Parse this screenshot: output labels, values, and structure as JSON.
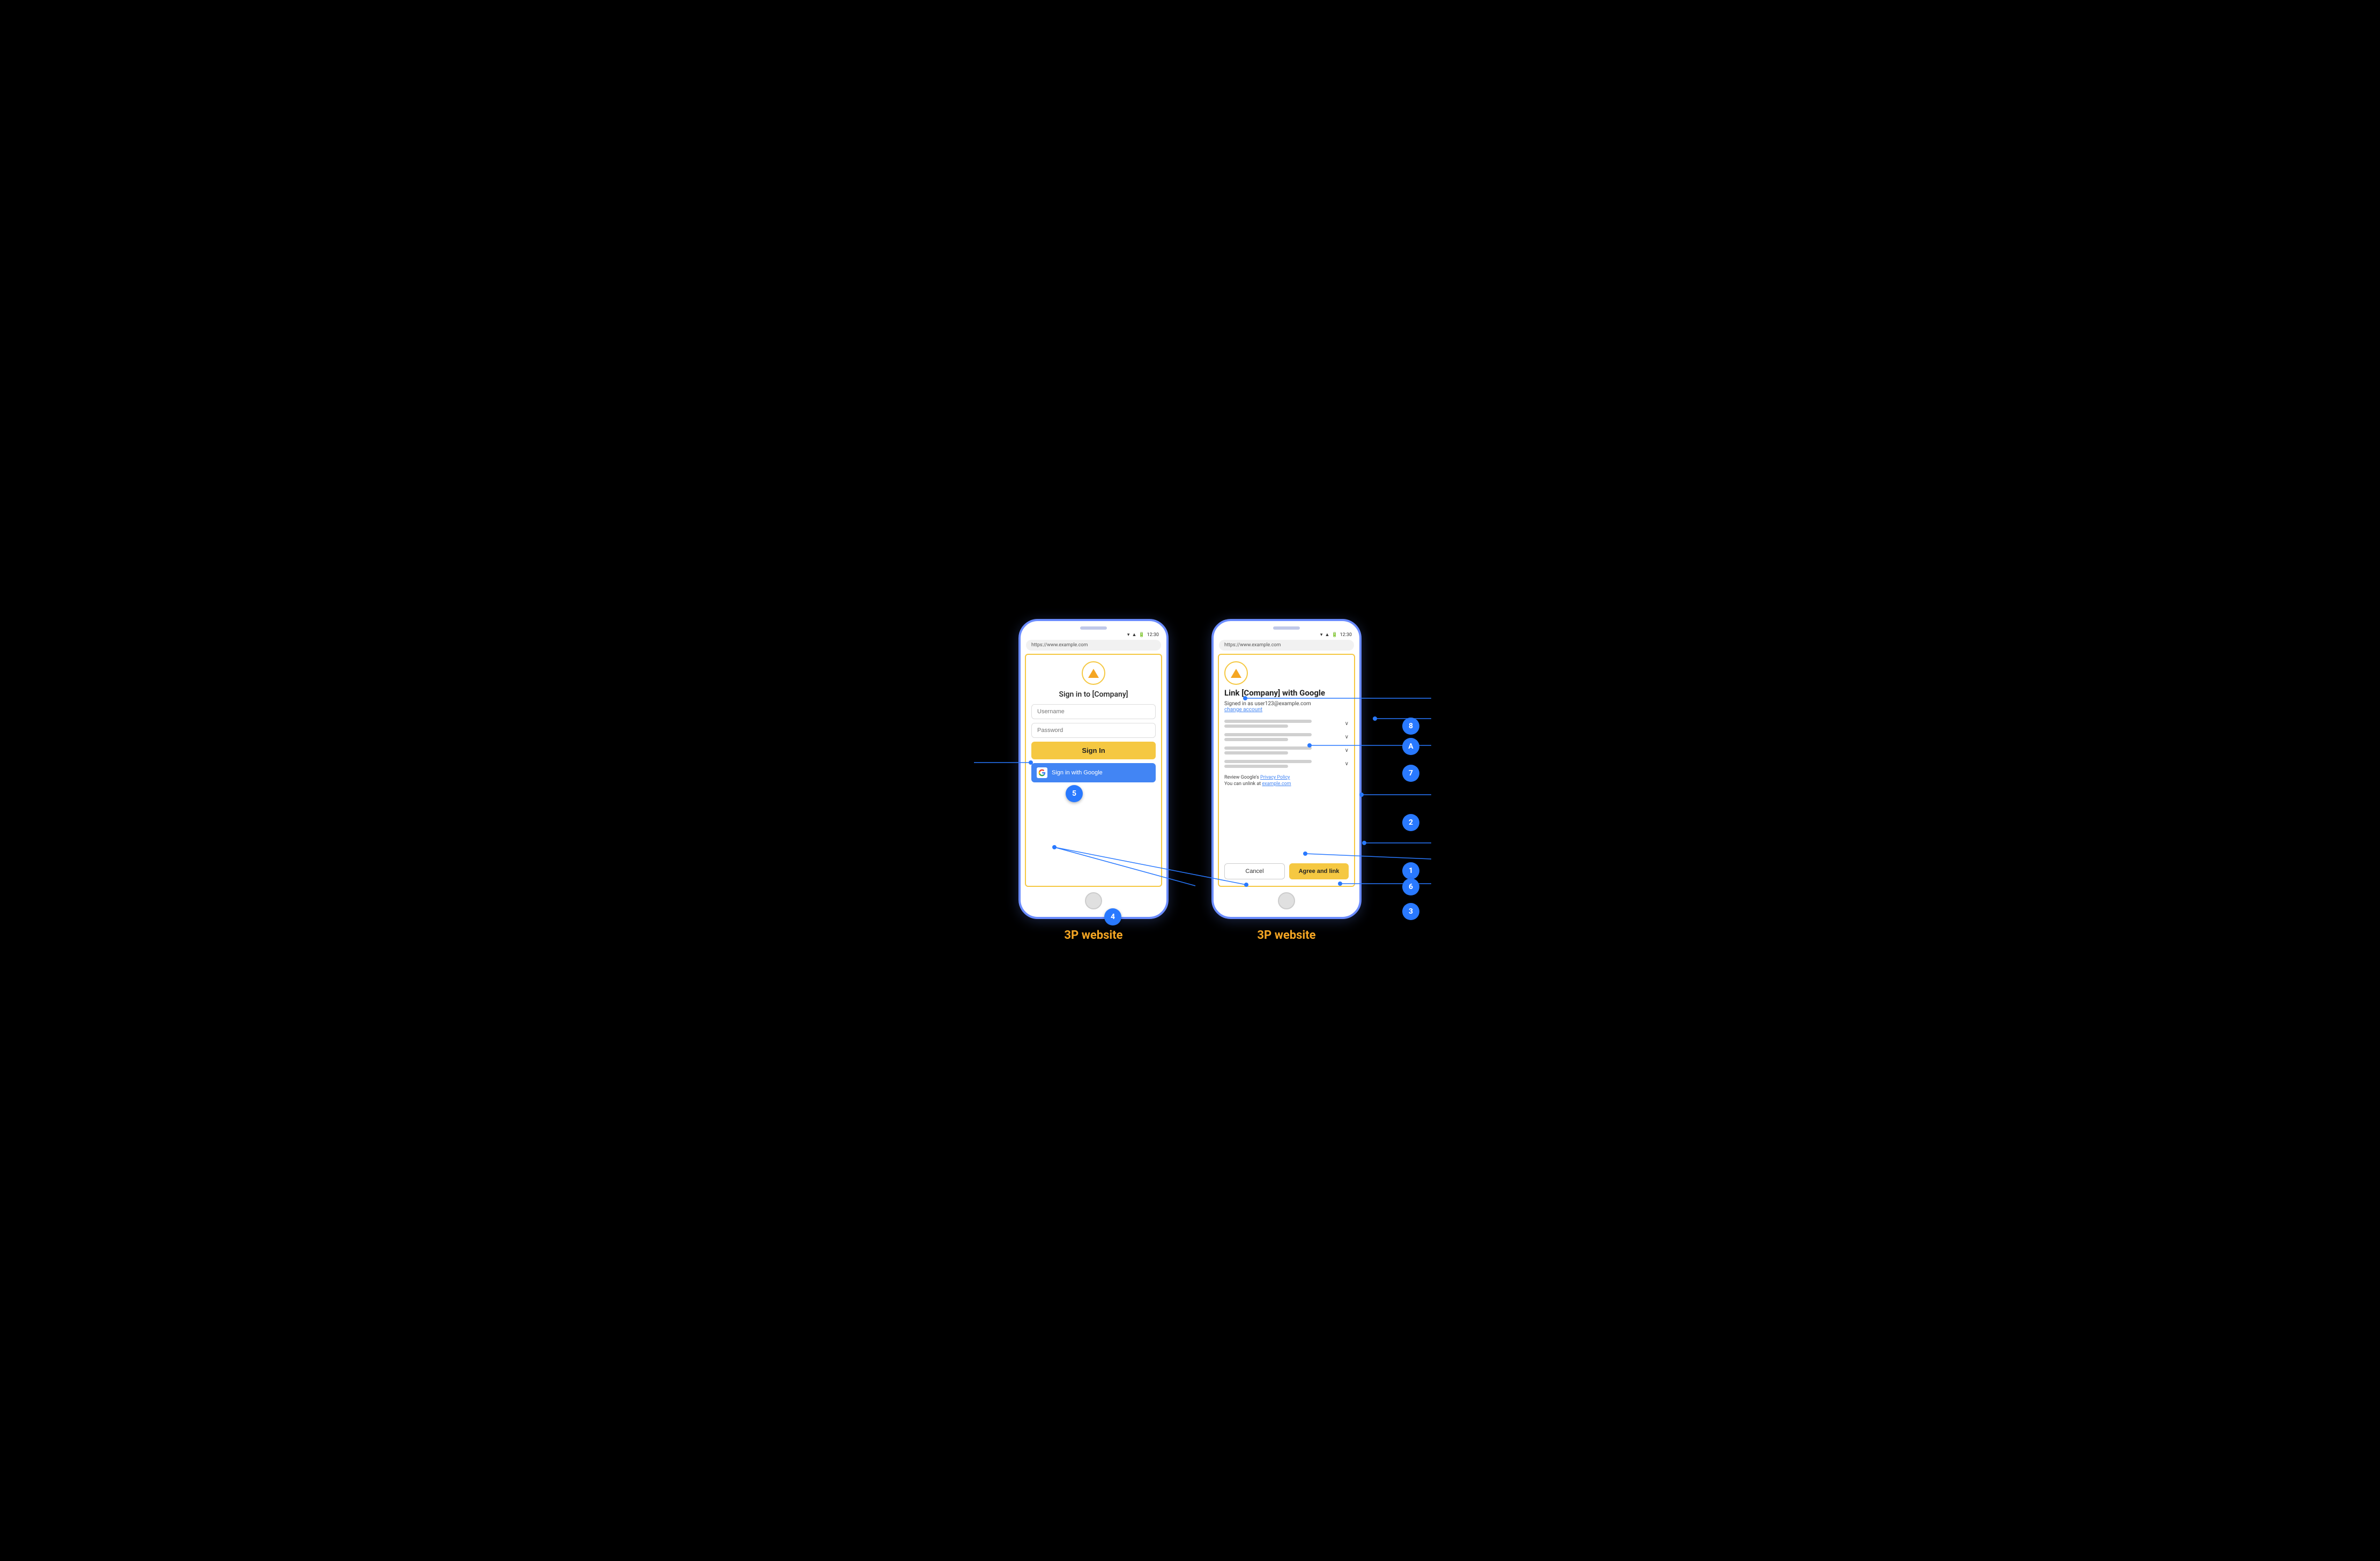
{
  "diagram": {
    "background": "#000000",
    "phones": [
      {
        "id": "left-phone",
        "label": "3P website",
        "url": "https://www.example.com",
        "time": "12:30",
        "content": {
          "logo": "triangle",
          "title": "Sign in to [Company]",
          "username_placeholder": "Username",
          "password_placeholder": "Password",
          "signin_button": "Sign In",
          "google_button": "Sign in with Google"
        }
      },
      {
        "id": "right-phone",
        "label": "3P website",
        "url": "https://www.example.com",
        "time": "12:30",
        "content": {
          "logo": "triangle",
          "title": "Link [Company] with Google",
          "signed_in_as": "Signed in as user123@example.com",
          "change_account": "change account",
          "privacy_text": "Review Google's",
          "privacy_link": "Privacy Policy",
          "unlink_text": "You can unlink at",
          "unlink_link": "example.com",
          "cancel_button": "Cancel",
          "agree_button": "Agree and link"
        }
      }
    ],
    "annotations": [
      {
        "id": "1",
        "label": "1"
      },
      {
        "id": "2",
        "label": "2"
      },
      {
        "id": "3",
        "label": "3"
      },
      {
        "id": "4",
        "label": "4"
      },
      {
        "id": "5",
        "label": "5"
      },
      {
        "id": "6",
        "label": "6"
      },
      {
        "id": "7",
        "label": "7"
      },
      {
        "id": "8",
        "label": "8"
      },
      {
        "id": "A",
        "label": "A"
      }
    ]
  }
}
